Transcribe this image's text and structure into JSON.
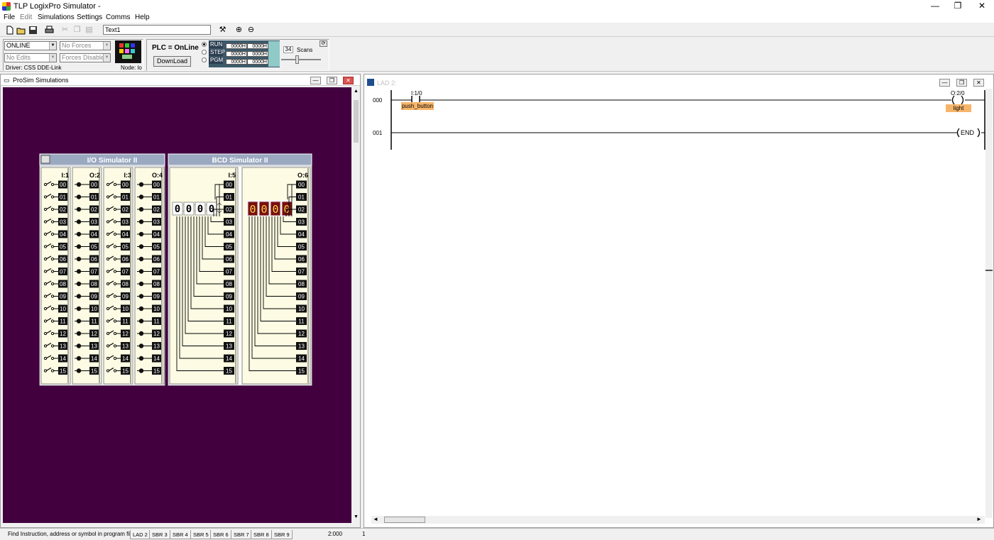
{
  "app": {
    "title": "TLP LogixPro Simulator  -",
    "min": "—",
    "max": "❐",
    "close": "✕"
  },
  "menu": [
    "File",
    "Edit",
    "Simulations",
    "Settings",
    "Comms",
    "Help"
  ],
  "toolbar": {
    "text_value": "Text1"
  },
  "status_panel": {
    "mode": "ONLINE",
    "forces": "No Forces",
    "edits": "No Edits",
    "forces_enabled": "Forces Disabled",
    "driver": "Driver: CSS DDE-Link",
    "node": "Node: lo",
    "plc_label": "PLC = OnLine",
    "download_label": "DownLoad",
    "run_label": "RUN",
    "step_label": "STEP",
    "pgm_label": "PGM",
    "selected_mode": "RUN",
    "registers": [
      "0000H",
      "0000H",
      "0000H",
      "0000H",
      "0000H",
      "0000H"
    ],
    "scans_value": "34",
    "scans_label": "Scans"
  },
  "prosim": {
    "title": "ProSim Simulations"
  },
  "io_sim": {
    "title": "I/O Simulator II",
    "columns": [
      {
        "label": "I:1",
        "type": "input"
      },
      {
        "label": "O:2",
        "type": "output"
      },
      {
        "label": "I:3",
        "type": "input"
      },
      {
        "label": "O:4",
        "type": "output"
      }
    ]
  },
  "bcd_sim": {
    "title": "BCD Simulator II",
    "input_label": "I:5",
    "output_label": "O:6",
    "input_digits": [
      "0",
      "0",
      "0",
      "0"
    ],
    "output_digits": [
      "0",
      "0",
      "0",
      "0"
    ]
  },
  "bits": [
    "00",
    "01",
    "02",
    "03",
    "04",
    "05",
    "06",
    "07",
    "08",
    "09",
    "10",
    "11",
    "12",
    "13",
    "14",
    "15"
  ],
  "ladder": {
    "title": "LAD 2:",
    "rungs": [
      {
        "number": "000",
        "contact_address": "I:1/0",
        "contact_symbol": "push_button",
        "coil_address": "O:2/0",
        "coil_symbol": "light"
      },
      {
        "number": "001",
        "end_label": "END"
      }
    ]
  },
  "statusbar": {
    "hint": "Find Instruction, address or symbol in program file",
    "tabs": [
      "LAD 2",
      "SBR 3",
      "SBR 4",
      "SBR 5",
      "SBR 6",
      "SBR 7",
      "SBR 8",
      "SBR 9"
    ],
    "position": "2:000",
    "index": "1"
  },
  "colors": {
    "sim_background": "#42003f",
    "panel_title": "#9aa8c0",
    "panel_body": "#fdfbe3",
    "bcd_output": "#7a0f0f",
    "tag": "#f6b56b"
  }
}
